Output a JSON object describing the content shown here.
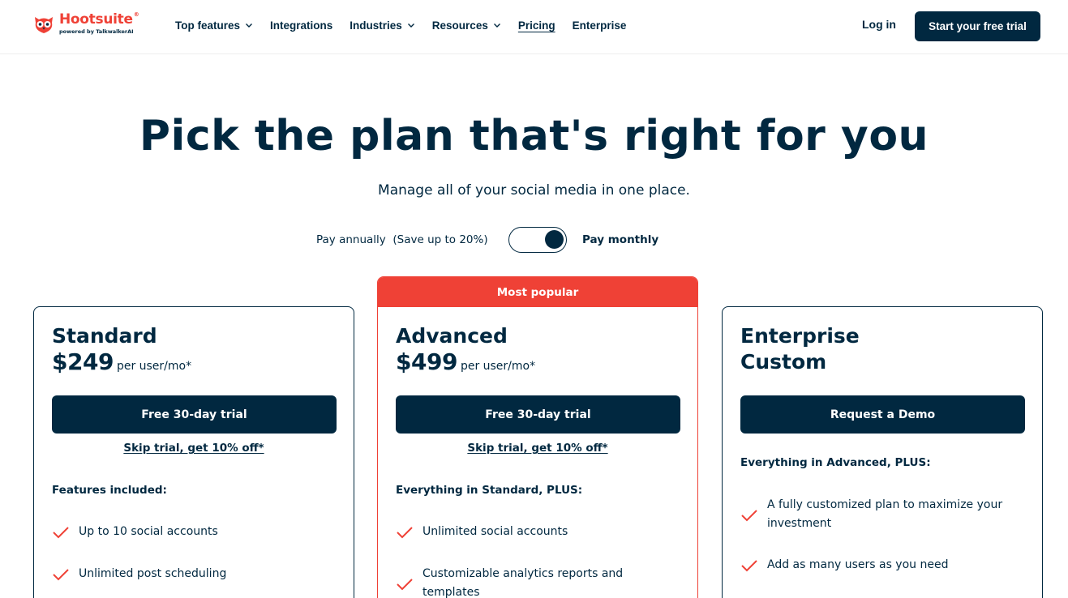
{
  "brand": {
    "name": "Hootsuite",
    "reg_mark": "®",
    "tagline": "powered by TalkwalkerAI",
    "color": "#ef4136"
  },
  "nav": {
    "items": [
      {
        "label": "Top features",
        "has_dropdown": true
      },
      {
        "label": "Integrations",
        "has_dropdown": false
      },
      {
        "label": "Industries",
        "has_dropdown": true
      },
      {
        "label": "Resources",
        "has_dropdown": true
      },
      {
        "label": "Pricing",
        "has_dropdown": false,
        "active": true
      },
      {
        "label": "Enterprise",
        "has_dropdown": false
      }
    ],
    "login_label": "Log in",
    "cta_label": "Start your free trial"
  },
  "hero": {
    "title": "Pick the plan that's right for you",
    "subtitle": "Manage all of your social media in one place."
  },
  "billing": {
    "annual_label": "Pay annually  (Save up to 20%)",
    "monthly_label": "Pay monthly",
    "selected": "monthly"
  },
  "plans": [
    {
      "name": "Standard",
      "price": "$249",
      "price_unit": "per user/mo*",
      "button_label": "Free 30-day trial",
      "skip_label": "Skip trial, get 10% off*",
      "features_heading": "Features included:",
      "features": [
        "Up to 10 social accounts",
        "Unlimited post scheduling"
      ]
    },
    {
      "badge": "Most popular",
      "name": "Advanced",
      "price": "$499",
      "price_unit": "per user/mo*",
      "button_label": "Free 30-day trial",
      "skip_label": "Skip trial, get 10% off*",
      "features_heading": "Everything in Standard, PLUS:",
      "features": [
        "Unlimited social accounts",
        "Customizable analytics reports and templates"
      ]
    },
    {
      "name_line1": "Enterprise",
      "name_line2": "Custom",
      "button_label": "Request a Demo",
      "features_heading": "Everything in Advanced, PLUS:",
      "features": [
        "A fully customized plan to maximize your investment",
        "Add as many users as you need"
      ]
    }
  ],
  "colors": {
    "navy": "#012840",
    "accent_red": "#ef4136"
  },
  "icons": {
    "feature_check": "check-icon",
    "dropdown": "chevron-down-icon",
    "logo": "owl-logo-icon"
  }
}
